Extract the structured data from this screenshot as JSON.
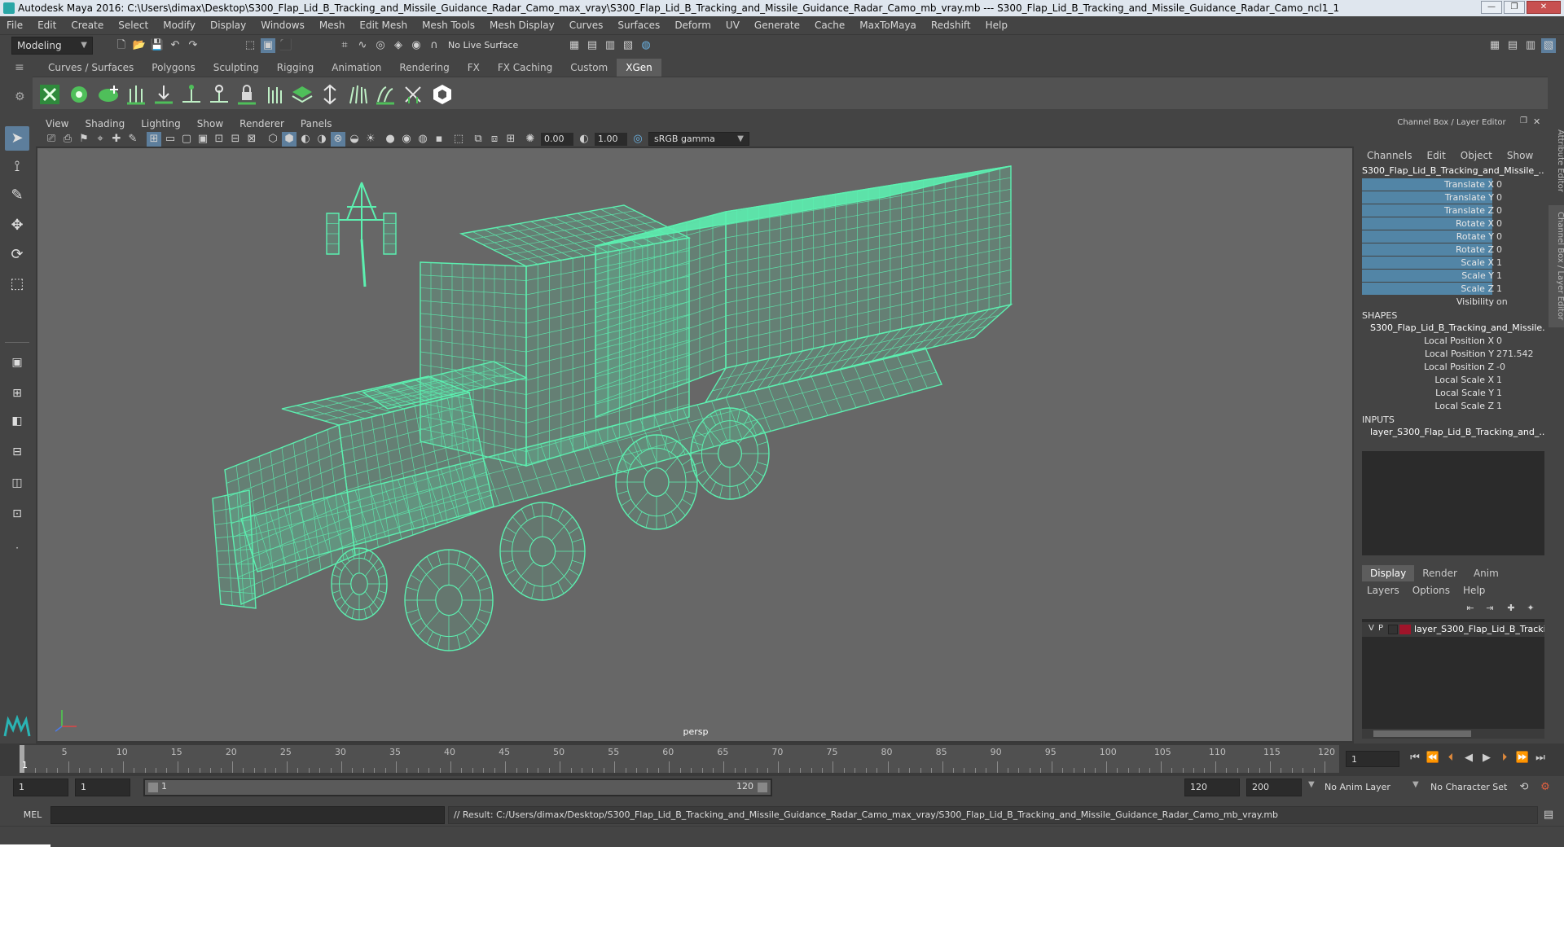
{
  "window": {
    "title": "Autodesk Maya 2016: C:\\Users\\dimax\\Desktop\\S300_Flap_Lid_B_Tracking_and_Missile_Guidance_Radar_Camo_max_vray\\S300_Flap_Lid_B_Tracking_and_Missile_Guidance_Radar_Camo_mb_vray.mb  ---  S300_Flap_Lid_B_Tracking_and_Missile_Guidance_Radar_Camo_ncl1_1",
    "minimize": "—",
    "maximize": "❐",
    "close": "✕"
  },
  "menubar": [
    "File",
    "Edit",
    "Create",
    "Select",
    "Modify",
    "Display",
    "Windows",
    "Mesh",
    "Edit Mesh",
    "Mesh Tools",
    "Mesh Display",
    "Curves",
    "Surfaces",
    "Deform",
    "UV",
    "Generate",
    "Cache",
    "MaxToMaya",
    "Redshift",
    "Help"
  ],
  "statusline": {
    "mode": "Modeling",
    "live_surface": "No Live Surface"
  },
  "shelf_tabs": [
    "Curves / Surfaces",
    "Polygons",
    "Sculpting",
    "Rigging",
    "Animation",
    "Rendering",
    "FX",
    "FX Caching",
    "Custom",
    "XGen"
  ],
  "shelf_active": "XGen",
  "panel_menu": [
    "View",
    "Shading",
    "Lighting",
    "Show",
    "Renderer",
    "Panels"
  ],
  "panel_toolbar": {
    "exposure": "0.00",
    "gamma": "1.00",
    "color_space": "sRGB gamma"
  },
  "viewport": {
    "camera": "persp",
    "wire_color": "#5cf0b0",
    "bg_color": "#676767"
  },
  "channel_box": {
    "header": "Channel Box / Layer Editor",
    "menu": [
      "Channels",
      "Edit",
      "Object",
      "Show"
    ],
    "object_name": "S300_Flap_Lid_B_Tracking_and_Missile_...",
    "channels": [
      {
        "label": "Translate X",
        "value": "0"
      },
      {
        "label": "Translate Y",
        "value": "0"
      },
      {
        "label": "Translate Z",
        "value": "0"
      },
      {
        "label": "Rotate X",
        "value": "0"
      },
      {
        "label": "Rotate Y",
        "value": "0"
      },
      {
        "label": "Rotate Z",
        "value": "0"
      },
      {
        "label": "Scale X",
        "value": "1"
      },
      {
        "label": "Scale Y",
        "value": "1"
      },
      {
        "label": "Scale Z",
        "value": "1"
      },
      {
        "label": "Visibility",
        "value": "on"
      }
    ],
    "shapes_header": "SHAPES",
    "shape_name": "S300_Flap_Lid_B_Tracking_and_Missile...",
    "shape_channels": [
      {
        "label": "Local Position X",
        "value": "0"
      },
      {
        "label": "Local Position Y",
        "value": "271.542"
      },
      {
        "label": "Local Position Z",
        "value": "-0"
      },
      {
        "label": "Local Scale X",
        "value": "1"
      },
      {
        "label": "Local Scale Y",
        "value": "1"
      },
      {
        "label": "Local Scale Z",
        "value": "1"
      }
    ],
    "inputs_header": "INPUTS",
    "input_name": "layer_S300_Flap_Lid_B_Tracking_and_..."
  },
  "side_tabs": {
    "attribute_editor": "Attribute Editor",
    "channel_box": "Channel Box / Layer Editor"
  },
  "layer_editor": {
    "tabs": [
      "Display",
      "Render",
      "Anim"
    ],
    "active_tab": "Display",
    "menu": [
      "Layers",
      "Options",
      "Help"
    ],
    "layers": [
      {
        "v": "V",
        "p": "P",
        "name": "layer_S300_Flap_Lid_B_Tracking",
        "color": "#a0142a"
      }
    ]
  },
  "timeline": {
    "ticks": [
      "5",
      "10",
      "15",
      "20",
      "25",
      "30",
      "35",
      "40",
      "45",
      "50",
      "55",
      "60",
      "65",
      "70",
      "75",
      "80",
      "85",
      "90",
      "95",
      "100",
      "105",
      "110",
      "115",
      "120"
    ],
    "current_frame_marker": "1",
    "current_frame": "1"
  },
  "range": {
    "start": "1",
    "playback_start": "1",
    "slider_start": "1",
    "slider_end": "120",
    "playback_end": "120",
    "end": "200",
    "anim_layer": "No Anim Layer",
    "character_set": "No Character Set"
  },
  "command_line": {
    "language": "MEL",
    "result": "// Result: C:/Users/dimax/Desktop/S300_Flap_Lid_B_Tracking_and_Missile_Guidance_Radar_Camo_max_vray/S300_Flap_Lid_B_Tracking_and_Missile_Guidance_Radar_Camo_mb_vray.mb"
  }
}
